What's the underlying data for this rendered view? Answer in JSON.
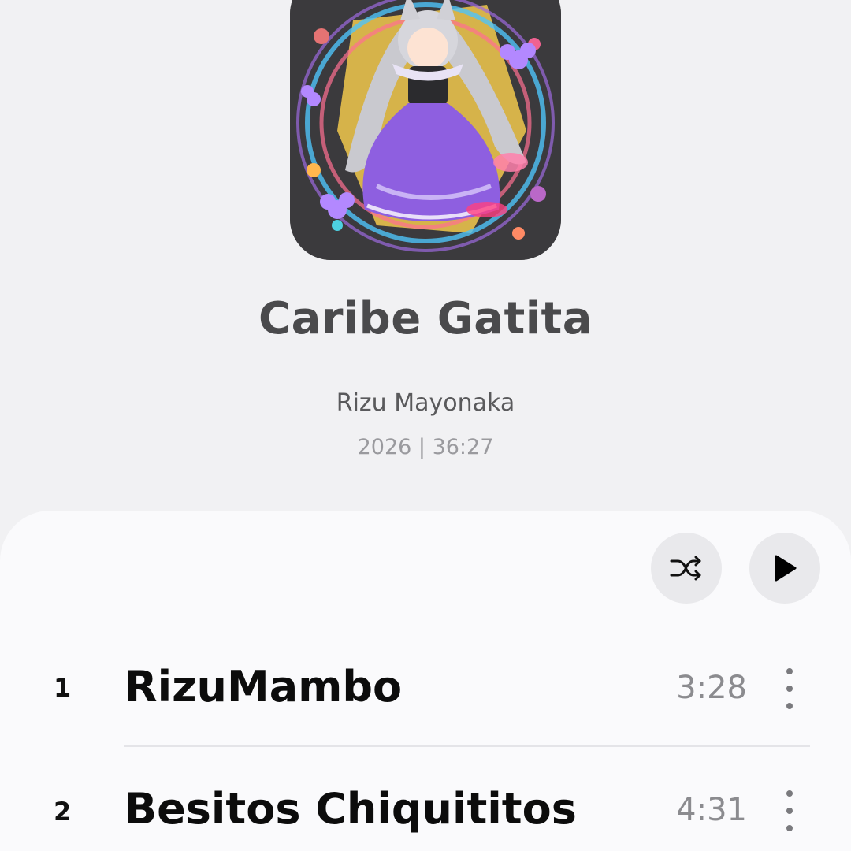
{
  "album": {
    "title": "Caribe Gatita",
    "artist": "Rizu Mayonaka",
    "meta": "2026 | 36:27"
  },
  "controls": {
    "shuffle_icon": "shuffle-icon",
    "play_icon": "play-icon"
  },
  "tracks": [
    {
      "number": "1",
      "title": "RizuMambo",
      "duration": "3:28"
    },
    {
      "number": "2",
      "title": "Besitos Chiquititos",
      "duration": "4:31"
    }
  ],
  "colors": {
    "background": "#f1f1f3",
    "sheet": "#fafafc",
    "button_bg": "#e9e9ec",
    "dress_purple": "#8e5fe0"
  }
}
